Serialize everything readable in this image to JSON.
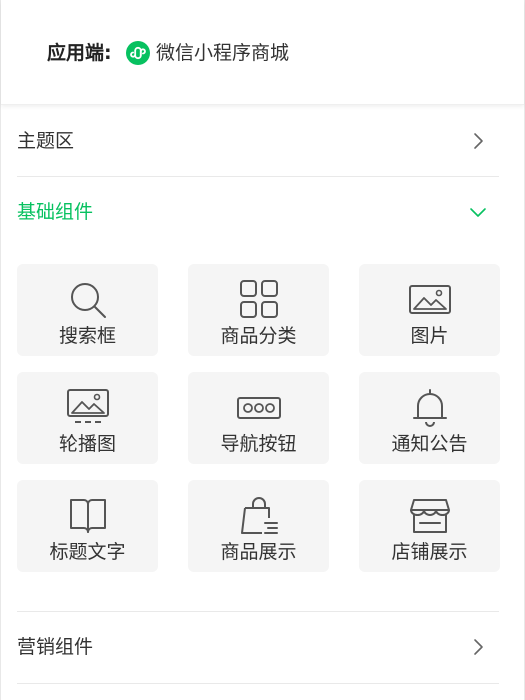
{
  "header": {
    "app_label": "应用端:",
    "app_value": "微信小程序商城",
    "app_icon": "wechat-miniprogram-icon",
    "app_icon_color": "#07c160"
  },
  "sections": {
    "theme": {
      "label": "主题区",
      "state": "collapsed"
    },
    "basic": {
      "label": "基础组件",
      "state": "expanded",
      "accent_color": "#07c160",
      "components": [
        {
          "label": "搜索框",
          "icon": "search-icon"
        },
        {
          "label": "商品分类",
          "icon": "grid-icon"
        },
        {
          "label": "图片",
          "icon": "image-icon"
        },
        {
          "label": "轮播图",
          "icon": "carousel-icon"
        },
        {
          "label": "导航按钮",
          "icon": "nav-button-icon"
        },
        {
          "label": "通知公告",
          "icon": "bell-icon"
        },
        {
          "label": "标题文字",
          "icon": "book-icon"
        },
        {
          "label": "商品展示",
          "icon": "shopping-bag-icon"
        },
        {
          "label": "店铺展示",
          "icon": "store-icon"
        }
      ]
    },
    "marketing": {
      "label": "营销组件",
      "state": "collapsed"
    }
  }
}
